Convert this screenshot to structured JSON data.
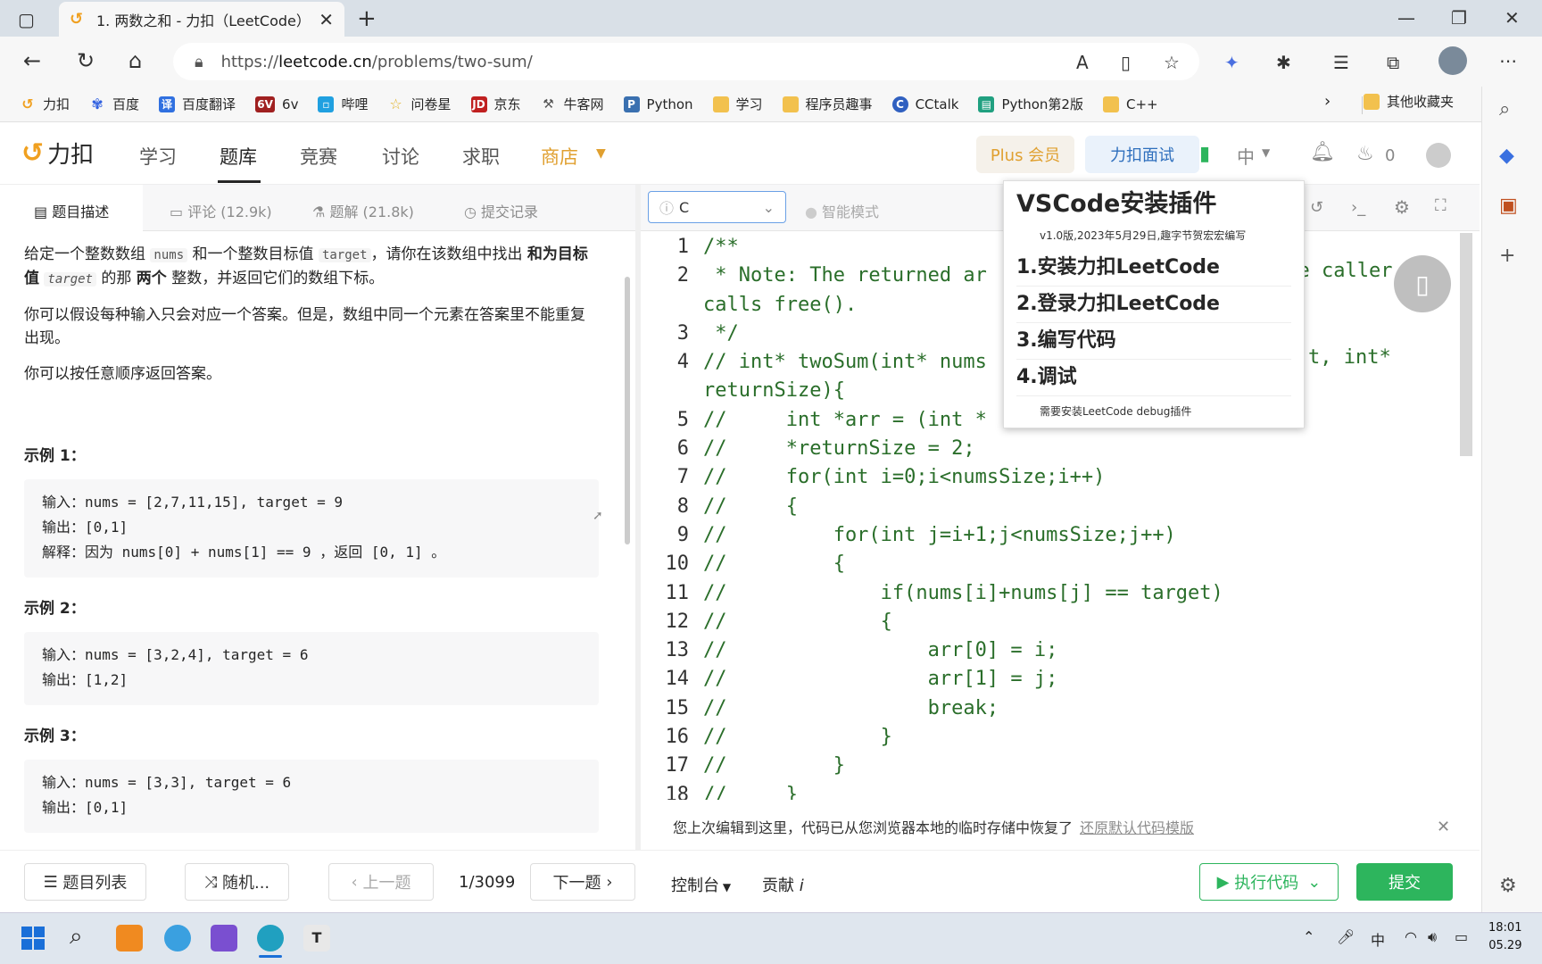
{
  "browser": {
    "tab_title": "1. 两数之和 - 力扣（LeetCode）",
    "url_prefix": "https://",
    "url_domain": "leetcode.cn",
    "url_path": "/problems/two-sum/",
    "bookmarks": [
      "力扣",
      "百度",
      "百度翻译",
      "6v",
      "哔哩",
      "问卷星",
      "京东",
      "牛客网",
      "Python",
      "学习",
      "程序员趣事",
      "CCtalk",
      "Python第2版",
      "C++"
    ],
    "other_bookmarks": "其他收藏夹"
  },
  "header": {
    "logo": "力扣",
    "nav": [
      "学习",
      "题库",
      "竞赛",
      "讨论",
      "求职",
      "商店"
    ],
    "plus": "Plus 会员",
    "interview": "力扣面试",
    "lang_toggle": "中",
    "streak": "0"
  },
  "left_tabs": {
    "desc": "题目描述",
    "comments": "评论 (12.9k)",
    "solutions": "题解 (21.8k)",
    "submissions": "提交记录"
  },
  "problem": {
    "p1_a": "给定一个整数数组 ",
    "p1_nums": "nums",
    "p1_b": " 和一个整数目标值 ",
    "p1_target": "target",
    "p1_c": "，请你在该数组中找出 ",
    "p1_bold1": "和为目标值",
    "p1_d": " ",
    "p1_target2": "target",
    "p1_e": "  的那 ",
    "p1_bold2": "两个",
    "p1_f": " 整数，并返回它们的数组下标。",
    "p2": "你可以假设每种输入只会对应一个答案。但是，数组中同一个元素在答案里不能重复出现。",
    "p3": "你可以按任意顺序返回答案。",
    "examples": [
      {
        "title": "示例 1：",
        "in": "输入：nums = [2,7,11,15], target = 9",
        "out": "输出：[0,1]",
        "exp": "解释：因为 nums[0] + nums[1] == 9 ，返回 [0, 1] 。"
      },
      {
        "title": "示例 2：",
        "in": "输入：nums = [3,2,4], target = 6",
        "out": "输出：[1,2]"
      },
      {
        "title": "示例 3：",
        "in": "输入：nums = [3,3], target = 6",
        "out": "输出：[0,1]"
      }
    ]
  },
  "editor": {
    "language": "C",
    "smart_mode": "智能模式",
    "lines": [
      {
        "n": "1",
        "t": "/**"
      },
      {
        "n": "2",
        "t": " * Note: The returned ar"
      },
      {
        "n": "",
        "t": "calls free()."
      },
      {
        "n": "3",
        "t": " */"
      },
      {
        "n": "4",
        "t": "// int* twoSum(int* nums"
      },
      {
        "n": "",
        "t": "returnSize){"
      },
      {
        "n": "5",
        "t": "//     int *arr = (int *"
      },
      {
        "n": "6",
        "t": "//     *returnSize = 2;"
      },
      {
        "n": "7",
        "t": "//     for(int i=0;i<numsSize;i++)"
      },
      {
        "n": "8",
        "t": "//     {"
      },
      {
        "n": "9",
        "t": "//         for(int j=i+1;j<numsSize;j++)"
      },
      {
        "n": "10",
        "t": "//         {"
      },
      {
        "n": "11",
        "t": "//             if(nums[i]+nums[j] == target)"
      },
      {
        "n": "12",
        "t": "//             {"
      },
      {
        "n": "13",
        "t": "//                 arr[0] = i;"
      },
      {
        "n": "14",
        "t": "//                 arr[1] = j;"
      },
      {
        "n": "15",
        "t": "//                 break;"
      },
      {
        "n": "16",
        "t": "//             }"
      },
      {
        "n": "17",
        "t": "//         }"
      },
      {
        "n": "18",
        "t": "//     }"
      }
    ],
    "overflow_right_l2": "ume caller",
    "overflow_right_l4": "t, int*",
    "restore_notice": "您上次编辑到这里，代码已从您浏览器本地的临时存储中恢复了",
    "restore_link": "还原默认代码模版"
  },
  "popup": {
    "title": "VSCode安装插件",
    "subtitle": "v1.0版,2023年5月29日,趣字节贺宏宏编写",
    "items": [
      "1.安装力扣LeetCode",
      "2.登录力扣LeetCode",
      "3.编写代码",
      "4.调试"
    ],
    "note": "需要安装LeetCode debug插件"
  },
  "bottom": {
    "list": "题目列表",
    "random": "随机...",
    "prev": "上一题",
    "page": "1/3099",
    "next": "下一题",
    "console": "控制台",
    "contribute": "贡献",
    "run": "执行代码",
    "submit": "提交"
  },
  "taskbar": {
    "ime": "中",
    "time": "18:01",
    "date": "05.29"
  }
}
